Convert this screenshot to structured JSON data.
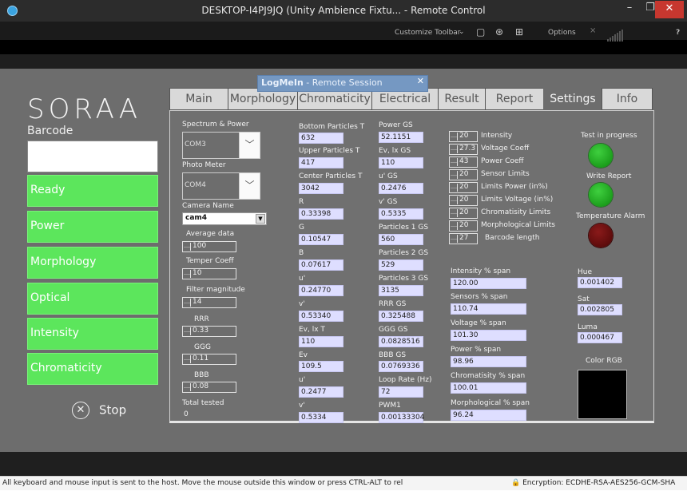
{
  "window": {
    "title": "DESKTOP-I4PJ9JQ (Unity Ambience Fixtu... - Remote Control",
    "min": "–",
    "max": "❐",
    "close": "✕"
  },
  "toolbar": {
    "customize": "Customize Toolbar",
    "chevron": "⌄",
    "options": "Options",
    "help": "?"
  },
  "logmein": {
    "brand": "LogMeIn",
    "suffix": " -  Remote Session",
    "close": "✕"
  },
  "app": {
    "logo": "SORAA",
    "barcode_label": "Barcode",
    "status_items": [
      "Ready",
      "Power",
      "Morphology",
      "Optical",
      "Intensity",
      "Chromaticity"
    ],
    "stop_label": "Stop",
    "stop_icon": "✕"
  },
  "tabs": [
    "Main",
    "Morphology",
    "Chromaticity",
    "Electrical",
    "Result",
    "Report",
    "Settings",
    "Info"
  ],
  "col1": {
    "spectrum_label": "Spectrum & Power",
    "spectrum_port": "COM3",
    "photo_label": "Photo Meter",
    "photo_port": "COM4",
    "camera_label": "Camera Name",
    "camera_value": "cam4",
    "average_label": "Average data",
    "average_value": "100",
    "temper_label": "Temper Coeff",
    "temper_value": "10",
    "filter_label": "Filter magnitude",
    "filter_value": "14",
    "rrr_label": "RRR",
    "rrr_value": "0.33",
    "ggg_label": "GGG",
    "ggg_value": "0.11",
    "bbb_label": "BBB",
    "bbb_value": "0.08",
    "total_label": "Total tested",
    "total_value": "0"
  },
  "col2": [
    {
      "label": "Bottom Particles T",
      "value": "632"
    },
    {
      "label": "Upper Particles T",
      "value": "417"
    },
    {
      "label": "Center Particles T",
      "value": "3042"
    },
    {
      "label": "R",
      "value": "0.33398"
    },
    {
      "label": "G",
      "value": "0.10547"
    },
    {
      "label": "B",
      "value": "0.07617"
    },
    {
      "label": "u'",
      "value": "0.24770"
    },
    {
      "label": "v'",
      "value": "0.53340"
    },
    {
      "label": "Ev, lx T",
      "value": "110"
    },
    {
      "label": "Ev",
      "value": "109.5"
    },
    {
      "label": "u'",
      "value": "0.2477"
    },
    {
      "label": "v'",
      "value": "0.5334"
    }
  ],
  "col3": [
    {
      "label": "Power GS",
      "value": "52.1151"
    },
    {
      "label": "Ev, lx GS",
      "value": "110"
    },
    {
      "label": "u'  GS",
      "value": "0.2476"
    },
    {
      "label": "v' GS",
      "value": "0.5335"
    },
    {
      "label": "Particles 1 GS",
      "value": "560"
    },
    {
      "label": "Particles 2 GS",
      "value": "529"
    },
    {
      "label": "Particles 3 GS",
      "value": "3135"
    },
    {
      "label": "RRR GS",
      "value": "0.325488"
    },
    {
      "label": "GGG GS",
      "value": "0.0828516"
    },
    {
      "label": "BBB GS",
      "value": "0.0769336"
    },
    {
      "label": "Loop Rate (Hz)",
      "value": "72"
    },
    {
      "label": "PWM1",
      "value": "0.00133304"
    }
  ],
  "limits": [
    {
      "value": "20",
      "label": "Intensity"
    },
    {
      "value": "27.3",
      "label": "Voltage Coeff"
    },
    {
      "value": "43",
      "label": "Power Coeff"
    },
    {
      "value": "20",
      "label": "Sensor Limits"
    },
    {
      "value": "20",
      "label": "Limits Power (in%)"
    },
    {
      "value": "20",
      "label": "Limits Voltage (in%)"
    },
    {
      "value": "20",
      "label": "Chromatisity Limits"
    },
    {
      "value": "20",
      "label": "Morphological Limits"
    },
    {
      "value": "27",
      "label": "Barcode length"
    }
  ],
  "spans": [
    {
      "label": "Intensity % span",
      "value": "120.00"
    },
    {
      "label": "Sensors % span",
      "value": "110.74"
    },
    {
      "label": "Voltage % span",
      "value": "101.30"
    },
    {
      "label": "Power % span",
      "value": "98.96"
    },
    {
      "label": "Chromatisity % span",
      "value": "100.01"
    },
    {
      "label": "Morphological % span",
      "value": "96.24"
    }
  ],
  "indicators": {
    "test_label": "Test in progress",
    "write_label": "Write Report",
    "temp_label": "Temperature Alarm",
    "test_color": "#1fa81f",
    "write_color": "#1fa81f",
    "temp_color": "#6a0f0f"
  },
  "color": {
    "hue_label": "Hue",
    "hue_value": "0.001402",
    "sat_label": "Sat",
    "sat_value": "0.002805",
    "luma_label": "Luma",
    "luma_value": "0.000467",
    "rgb_label": "Color RGB"
  },
  "infobar": {
    "message": "All keyboard and mouse input is sent to the host. Move the mouse outside this window or press CTRL-ALT to rel",
    "encryption": "Encryption: ECDHE-RSA-AES256-GCM-SHA"
  }
}
